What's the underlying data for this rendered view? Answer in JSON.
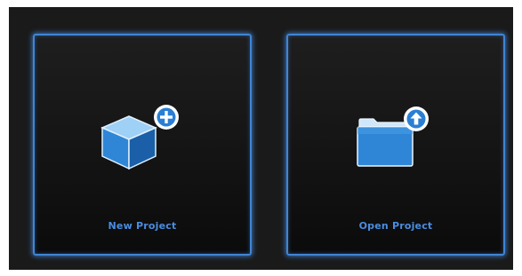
{
  "tiles": {
    "new_project": {
      "label": "New Project",
      "icon": "cube-plus-icon"
    },
    "open_project": {
      "label": "Open Project",
      "icon": "folder-upload-icon"
    }
  },
  "colors": {
    "background": "#1a1a1a",
    "accent": "#3f85d4",
    "label": "#4a8de0"
  }
}
